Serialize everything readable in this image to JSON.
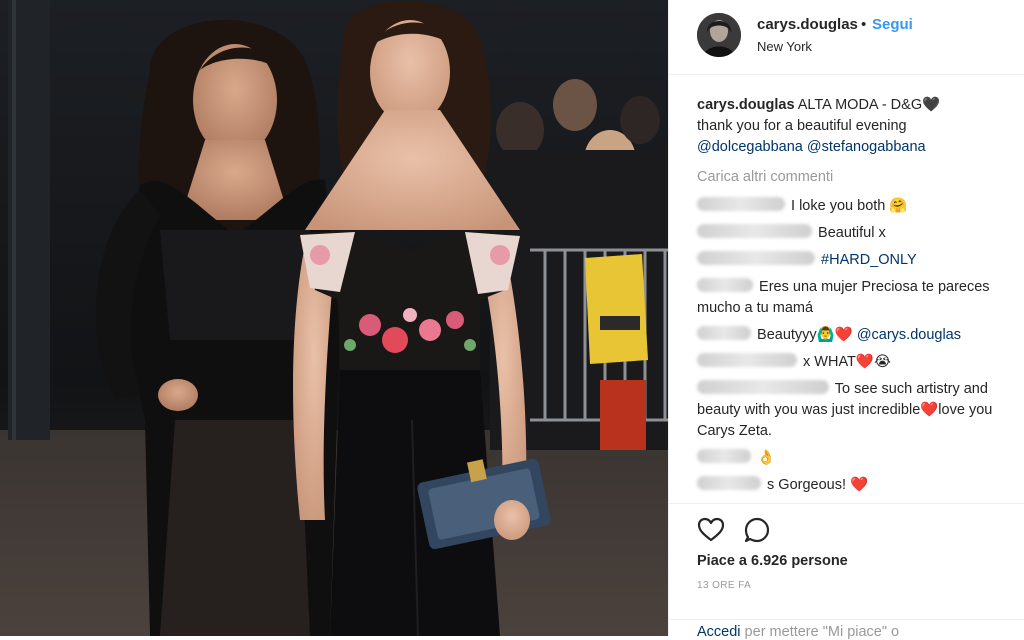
{
  "post": {
    "username": "carys.douglas",
    "separator": "•",
    "follow_label": "Segui",
    "location": "New York",
    "avatar_icon": "profile-avatar",
    "photo_alt": "photo-two-women-event"
  },
  "caption": {
    "username": "carys.douglas",
    "line1": " ALTA MODA - D&G🖤",
    "line2": "thank you for a beautiful evening",
    "tag1": "@dolcegabbana",
    "tag2": "@stefanogabbana"
  },
  "load_more_label": "Carica altri commenti",
  "comments": [
    {
      "text": "I loke you both 🤗",
      "tag": ""
    },
    {
      "text": "Beautiful x",
      "tag": ""
    },
    {
      "text": "",
      "tag": "#HARD_ONLY"
    },
    {
      "text": "Eres una mujer Preciosa te pareces mucho a tu mamá",
      "tag": ""
    },
    {
      "text": "Beautyyy🙆‍♂️❤️ ",
      "tag": "@carys.douglas"
    },
    {
      "text": "x WHAT❤️😭",
      "tag": ""
    },
    {
      "text": "To see such artistry and beauty with you was just incredible❤️love you Carys Zeta.",
      "tag": ""
    },
    {
      "text": "👌",
      "tag": ""
    },
    {
      "text": "s Gorgeous! ❤️",
      "tag": ""
    }
  ],
  "actions": {
    "like_icon": "heart-icon",
    "comment_icon": "comment-icon",
    "likes_text": "Piace a 6.926 persone",
    "timestamp": "13 ORE FA"
  },
  "login": {
    "link": "Accedi",
    "text": " per mettere \"Mi piace\" o"
  },
  "colors": {
    "link": "#003569",
    "follow": "#3897f0",
    "muted": "#999999",
    "border": "#efefef"
  }
}
